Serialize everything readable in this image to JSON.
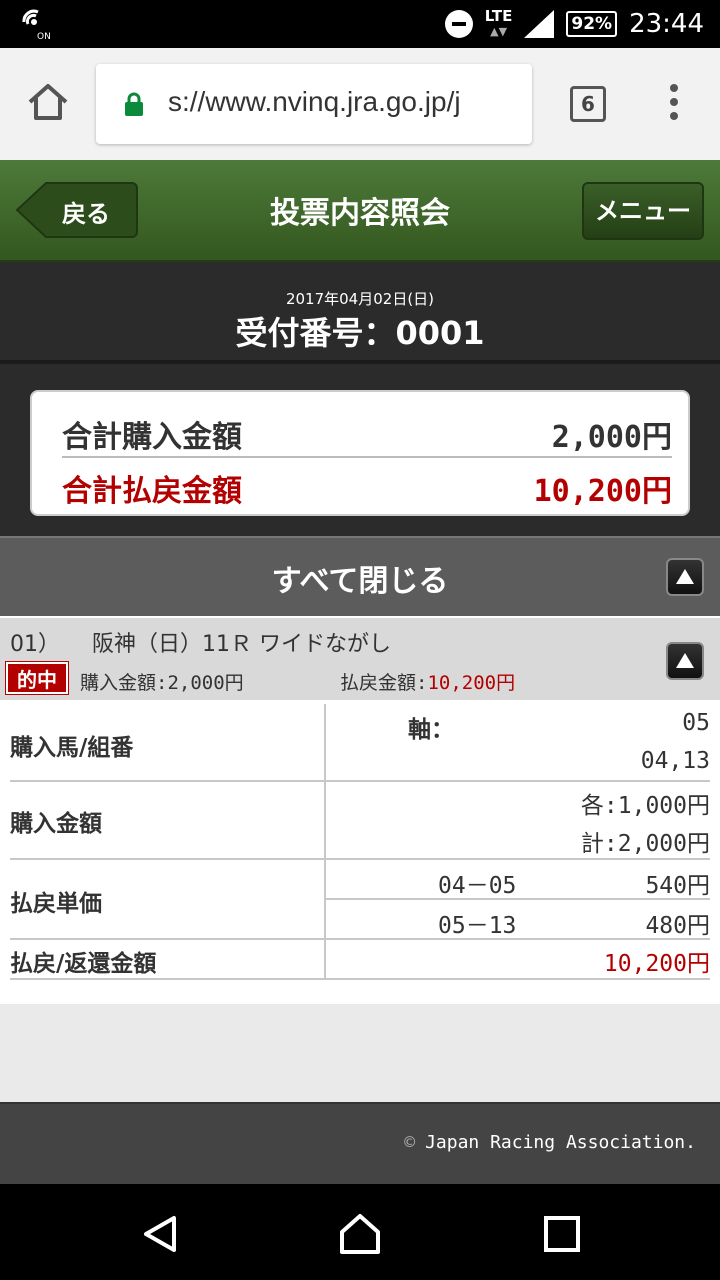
{
  "status_bar": {
    "network": "LTE",
    "battery": "92%",
    "time": "23:44",
    "icons": [
      "nfc-on-icon",
      "do-not-disturb-icon",
      "signal-icon",
      "battery-icon"
    ]
  },
  "browser": {
    "url": "s://www.nvinq.jra.go.jp/j",
    "tab_count": "6"
  },
  "header": {
    "back_label": "戻る",
    "title": "投票内容照会",
    "menu_label": "メニュー"
  },
  "receipt": {
    "date": "2017年04月02日(日)",
    "number_label": "受付番号：0001"
  },
  "summary": {
    "purchase_label": "合計購入金額",
    "purchase_value": "2,000円",
    "payout_label": "合計払戻金額",
    "payout_value": "10,200円"
  },
  "close_all": {
    "label": "すべて閉じる"
  },
  "bet": {
    "number": "01）",
    "race": "阪神（日）11Ｒ ワイドながし",
    "hit_badge": "的中",
    "buy_label": "購入金額:",
    "buy_value": "2,000円",
    "pay_label": "払戻金額:",
    "pay_value": "10,200円",
    "table": {
      "horses_label": "購入馬/組番",
      "axis_label": "軸：",
      "axis_value": "05",
      "partners": "04,13",
      "amount_label": "購入金額",
      "amount_each": "各:1,000円",
      "amount_total": "計:2,000円",
      "unit_label": "払戻単価",
      "unit_rows": [
        {
          "combo": "04－05",
          "price": "540円"
        },
        {
          "combo": "05－13",
          "price": "480円"
        }
      ],
      "refund_label": "払戻/返還金額",
      "refund_value": "10,200円"
    }
  },
  "footer": {
    "copyright_symbol": "©",
    "copyright": "Japan Racing Association."
  },
  "colors": {
    "header_green": "#3f6a2c",
    "accent_red": "#b30000",
    "dark_band": "#2b2b2b"
  }
}
